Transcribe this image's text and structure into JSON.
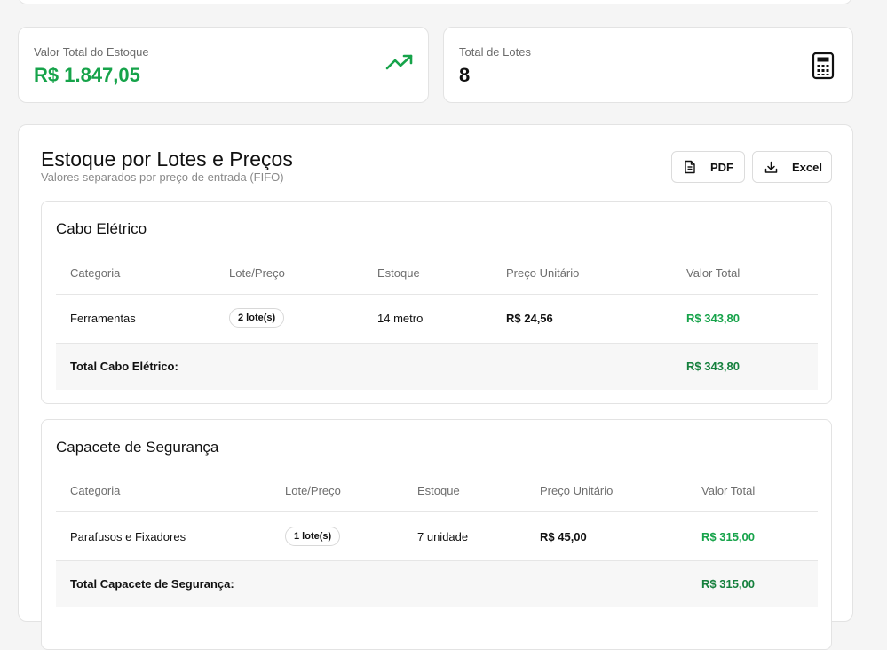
{
  "stats": {
    "total_value": {
      "label": "Valor Total do Estoque",
      "value": "R$ 1.847,05",
      "icon": "trending-up-icon"
    },
    "total_lots": {
      "label": "Total de Lotes",
      "value": "8",
      "icon": "calculator-icon"
    }
  },
  "main": {
    "title": "Estoque por Lotes e Preços",
    "subtitle": "Valores separados por preço de entrada (FIFO)",
    "pdf_label": "PDF",
    "excel_label": "Excel"
  },
  "groups": [
    {
      "title": "Cabo Elétrico",
      "headers": [
        "Categoria",
        "Lote/Preço",
        "Estoque",
        "Preço Unitário",
        "Valor Total"
      ],
      "row": {
        "categoria": "Ferramentas",
        "lote": "2 lote(s)",
        "estoque": "14 metro",
        "preco": "R$ 24,56",
        "valor": "R$ 343,80"
      },
      "total_label": "Total Cabo Elétrico:",
      "total_value": "R$ 343,80"
    },
    {
      "title": "Capacete de Segurança",
      "headers": [
        "Categoria",
        "Lote/Preço",
        "Estoque",
        "Preço Unitário",
        "Valor Total"
      ],
      "row": {
        "categoria": "Parafusos e Fixadores",
        "lote": "1 lote(s)",
        "estoque": "7 unidade",
        "preco": "R$ 45,00",
        "valor": "R$ 315,00"
      },
      "total_label": "Total Capacete de Segurança:",
      "total_value": "R$ 315,00"
    }
  ],
  "colors": {
    "accent_green": "#16a34a",
    "background": "#f5f5f5"
  }
}
